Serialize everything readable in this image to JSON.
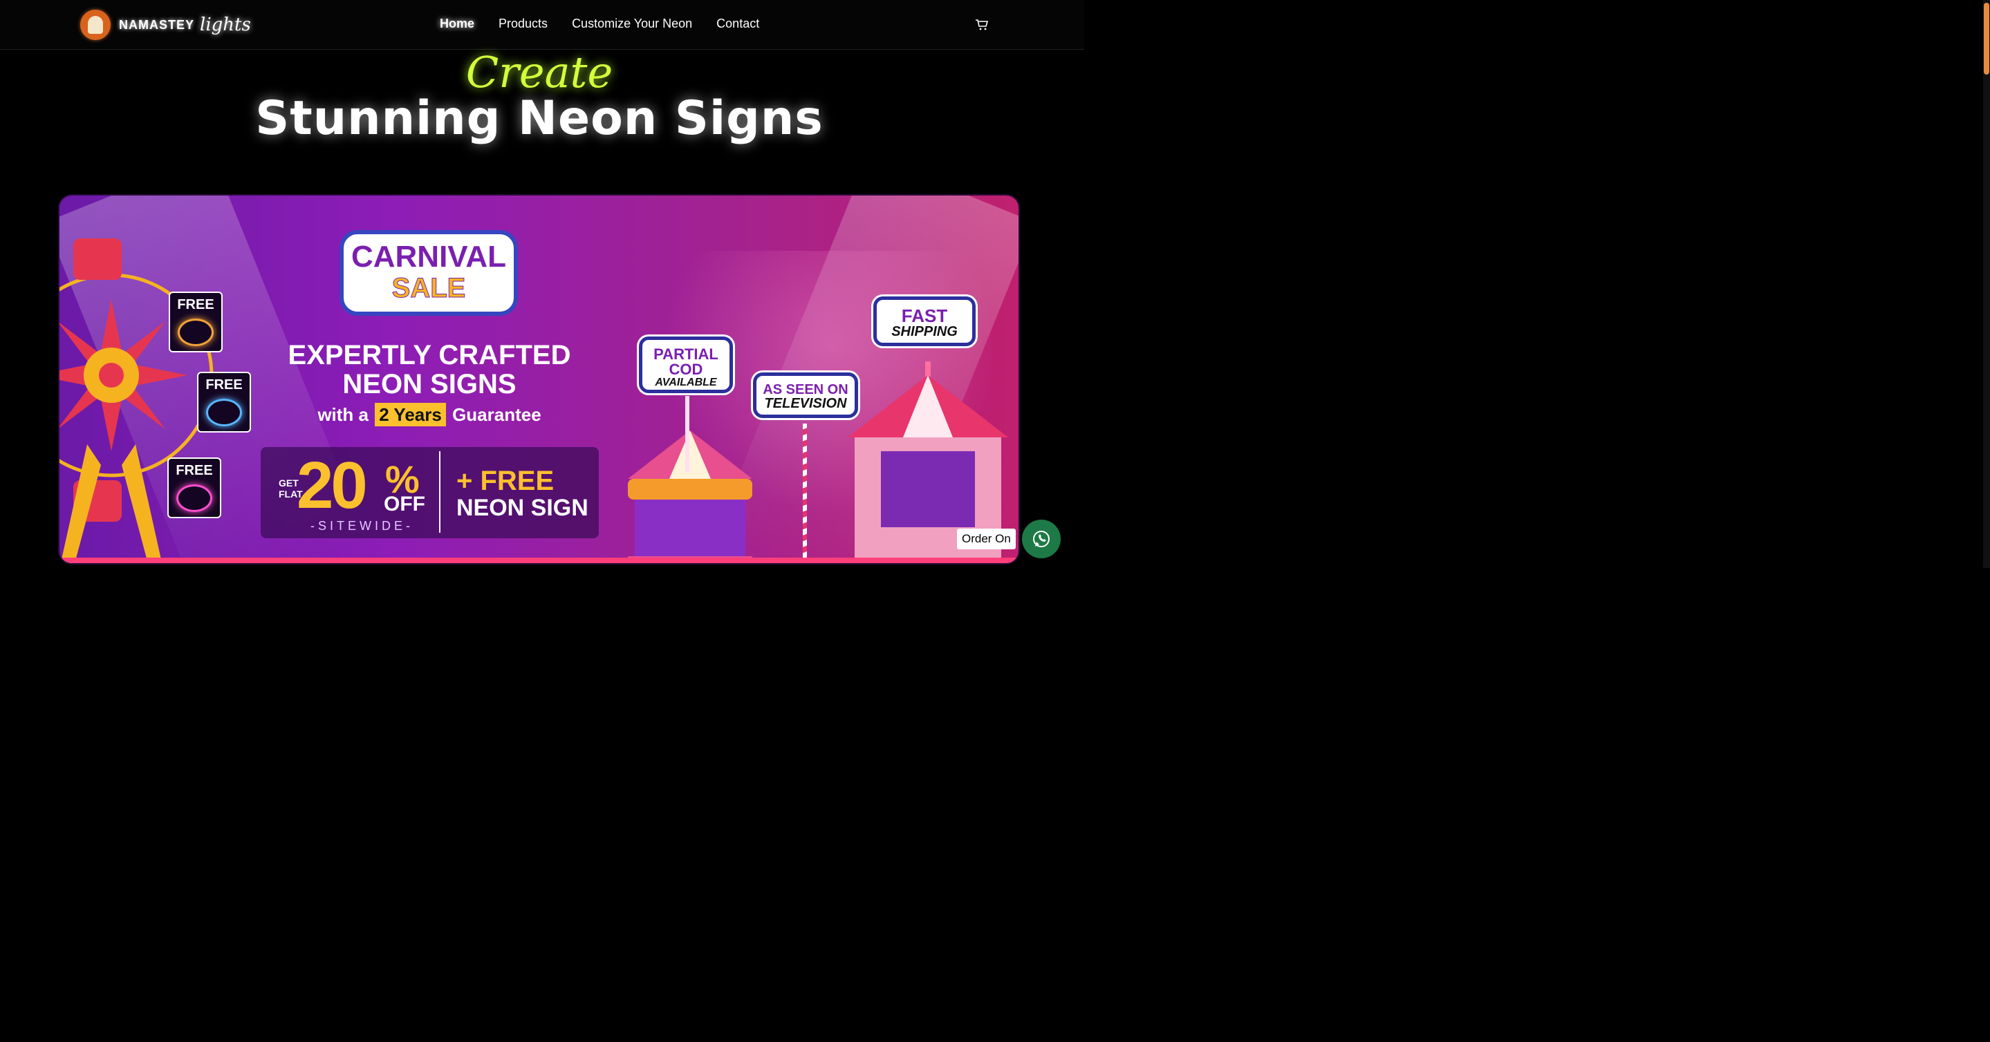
{
  "header": {
    "brand_main": "NAMASTEY",
    "brand_script": "lights",
    "nav": [
      "Home",
      "Products",
      "Customize Your Neon",
      "Contact"
    ],
    "active_nav": "Home"
  },
  "hero": {
    "create": "Create",
    "title": "Stunning Neon  Signs"
  },
  "banner": {
    "sale_line1": "CARNIVAL",
    "sale_line2": "SALE",
    "headline1": "EXPERTLY CRAFTED",
    "headline2": "NEON SIGNS",
    "guarantee_pre": "with a",
    "guarantee_highlight": "2 Years",
    "guarantee_post": "Guarantee",
    "get": "GET",
    "flat": "FLAT",
    "percent": "20",
    "percent_sign": "%",
    "off": "OFF",
    "sitewide": "-SITEWIDE-",
    "free_sign1": "+ FREE",
    "free_sign2": "NEON SIGN",
    "free_tiles": [
      "FREE",
      "FREE",
      "FREE"
    ],
    "badges": {
      "cod1": "PARTIAL",
      "cod2": "COD",
      "cod3": "AVAILABLE",
      "tv1": "AS SEEN ON",
      "tv2": "TELEVISION",
      "ship1": "FAST",
      "ship2": "SHIPPING"
    }
  },
  "chat": {
    "label": "Order On",
    "icon": "whatsapp-icon"
  },
  "icons": {
    "cart": "cart-icon"
  },
  "colors": {
    "accent_green": "#d4ff3c",
    "brand_orange": "#d9621d",
    "banner_purple": "#7b1eb0",
    "badge_blue": "#2c2f9c",
    "highlight_yellow": "#fbc02d",
    "whatsapp_green": "#1d7a46"
  }
}
